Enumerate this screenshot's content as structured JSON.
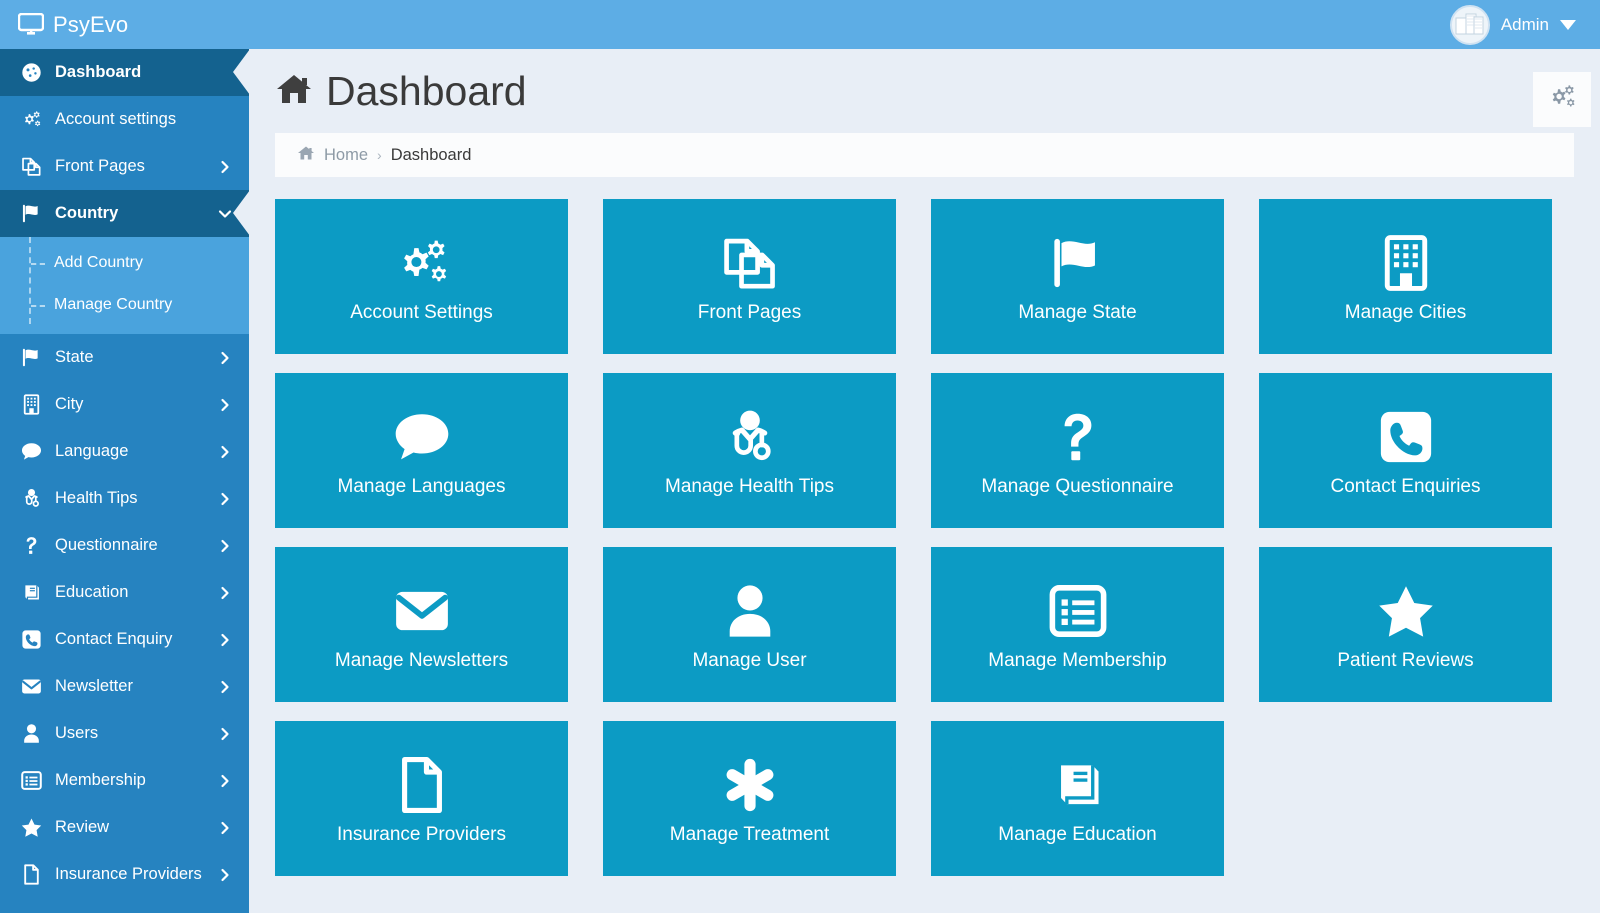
{
  "header": {
    "brand": "PsyEvo",
    "brand_icon": "desktop-monitor-icon",
    "user_name": "Admin",
    "avatar_icon": "user-avatar-image",
    "caret_icon": "caret-down-icon"
  },
  "sidebar": {
    "items": [
      {
        "label": "Dashboard",
        "icon": "dashboard-gauge-icon",
        "active": true,
        "expandable": false,
        "expanded": false
      },
      {
        "label": "Account settings",
        "icon": "cogs-icon",
        "active": false,
        "expandable": false,
        "expanded": false
      },
      {
        "label": "Front Pages",
        "icon": "copy-pages-icon",
        "active": false,
        "expandable": true,
        "expanded": false
      },
      {
        "label": "Country",
        "icon": "flag-icon",
        "active": true,
        "expandable": true,
        "expanded": true,
        "children": [
          {
            "label": "Add Country"
          },
          {
            "label": "Manage Country"
          }
        ]
      },
      {
        "label": "State",
        "icon": "flag-icon",
        "active": false,
        "expandable": true,
        "expanded": false
      },
      {
        "label": "City",
        "icon": "building-icon",
        "active": false,
        "expandable": true,
        "expanded": false
      },
      {
        "label": "Language",
        "icon": "comment-icon",
        "active": false,
        "expandable": true,
        "expanded": false
      },
      {
        "label": "Health Tips",
        "icon": "doctor-icon",
        "active": false,
        "expandable": true,
        "expanded": false
      },
      {
        "label": "Questionnaire",
        "icon": "question-mark-icon",
        "active": false,
        "expandable": true,
        "expanded": false
      },
      {
        "label": "Education",
        "icon": "book-icon",
        "active": false,
        "expandable": true,
        "expanded": false
      },
      {
        "label": "Contact Enquiry",
        "icon": "phone-icon",
        "active": false,
        "expandable": true,
        "expanded": false
      },
      {
        "label": "Newsletter",
        "icon": "envelope-icon",
        "active": false,
        "expandable": true,
        "expanded": false
      },
      {
        "label": "Users",
        "icon": "user-icon",
        "active": false,
        "expandable": true,
        "expanded": false
      },
      {
        "label": "Membership",
        "icon": "list-card-icon",
        "active": false,
        "expandable": true,
        "expanded": false
      },
      {
        "label": "Review",
        "icon": "star-icon",
        "active": false,
        "expandable": true,
        "expanded": false
      },
      {
        "label": "Insurance Providers",
        "icon": "file-icon",
        "active": false,
        "expandable": true,
        "expanded": false
      }
    ]
  },
  "page": {
    "title": "Dashboard",
    "title_icon": "home-icon",
    "settings_button_icon": "cogs-icon",
    "breadcrumb": {
      "home_icon": "home-icon",
      "home": "Home",
      "separator": "›",
      "current": "Dashboard"
    }
  },
  "tiles": [
    {
      "label": "Account Settings",
      "icon": "cogs-icon"
    },
    {
      "label": "Front Pages",
      "icon": "copy-pages-icon"
    },
    {
      "label": "Manage State",
      "icon": "flag-icon"
    },
    {
      "label": "Manage Cities",
      "icon": "building-icon"
    },
    {
      "label": "Manage Languages",
      "icon": "comment-icon"
    },
    {
      "label": "Manage Health Tips",
      "icon": "doctor-icon"
    },
    {
      "label": "Manage Questionnaire",
      "icon": "question-mark-icon"
    },
    {
      "label": "Contact Enquiries",
      "icon": "phone-square-icon"
    },
    {
      "label": "Manage Newsletters",
      "icon": "envelope-icon"
    },
    {
      "label": "Manage User",
      "icon": "user-icon"
    },
    {
      "label": "Manage Membership",
      "icon": "list-card-icon"
    },
    {
      "label": "Patient Reviews",
      "icon": "star-icon"
    },
    {
      "label": "Insurance Providers",
      "icon": "file-icon"
    },
    {
      "label": "Manage Treatment",
      "icon": "asterisk-medical-icon"
    },
    {
      "label": "Manage Education",
      "icon": "book-icon"
    }
  ],
  "colors": {
    "header_blue": "#5dade5",
    "sidebar_blue": "#2683c0",
    "sidebar_active": "#14628f",
    "submenu_blue": "#4aa3dd",
    "tile_teal": "#0c9bc4",
    "content_bg": "#e8eef6",
    "panel_white": "#fbfcfd"
  }
}
